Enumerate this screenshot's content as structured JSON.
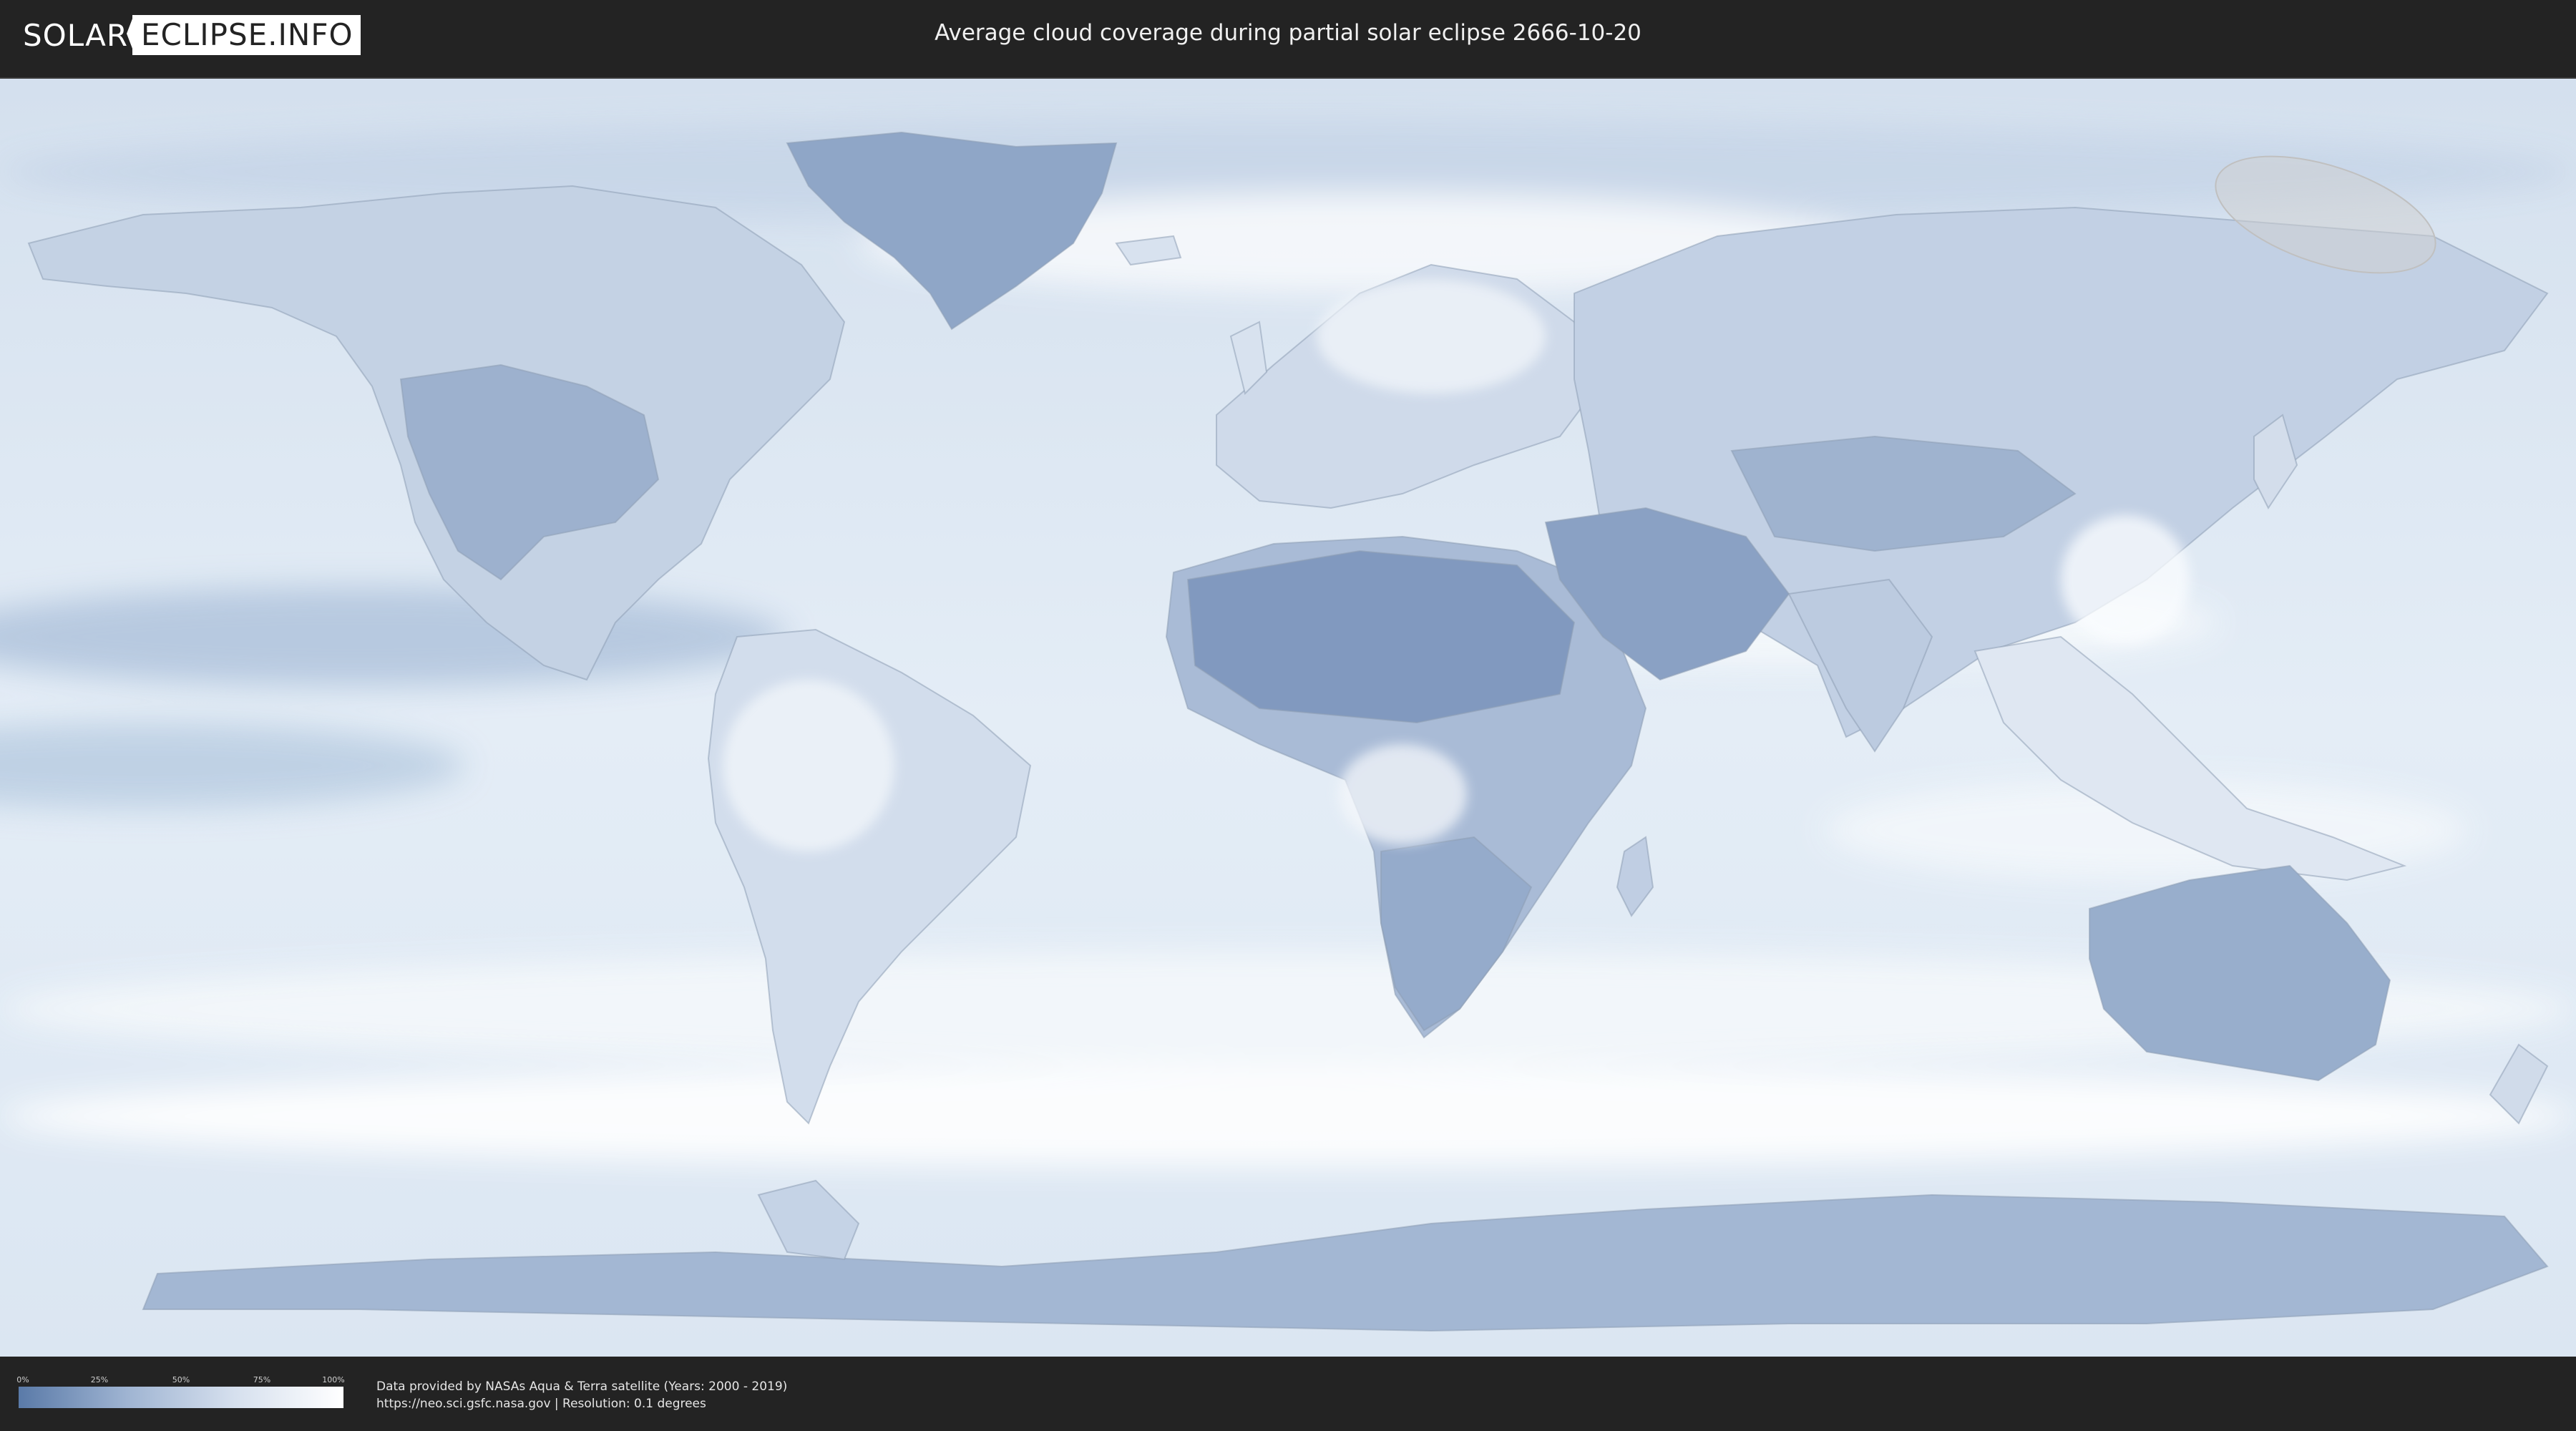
{
  "header": {
    "logo_part1": "SOLAR",
    "logo_part2": "ECLIPSE.INFO",
    "title": "Average cloud coverage during partial solar eclipse 2666-10-20"
  },
  "legend": {
    "ticks": [
      "0%",
      "25%",
      "50%",
      "75%",
      "100%"
    ],
    "gradient_colors": [
      "#5a7aa8",
      "#9fb4d2",
      "#d6e0ee",
      "#ffffff"
    ]
  },
  "credits": {
    "line1": "Data provided by NASAs Aqua & Terra satellite (Years: 2000 - 2019)",
    "line2": "https://neo.sci.gsfc.nasa.gov | Resolution: 0.1 degrees"
  },
  "colors": {
    "background": "#232323",
    "clear_sky": "#5a7aa8",
    "overcast": "#ffffff",
    "eclipse_zone": "#d0d0d0"
  }
}
